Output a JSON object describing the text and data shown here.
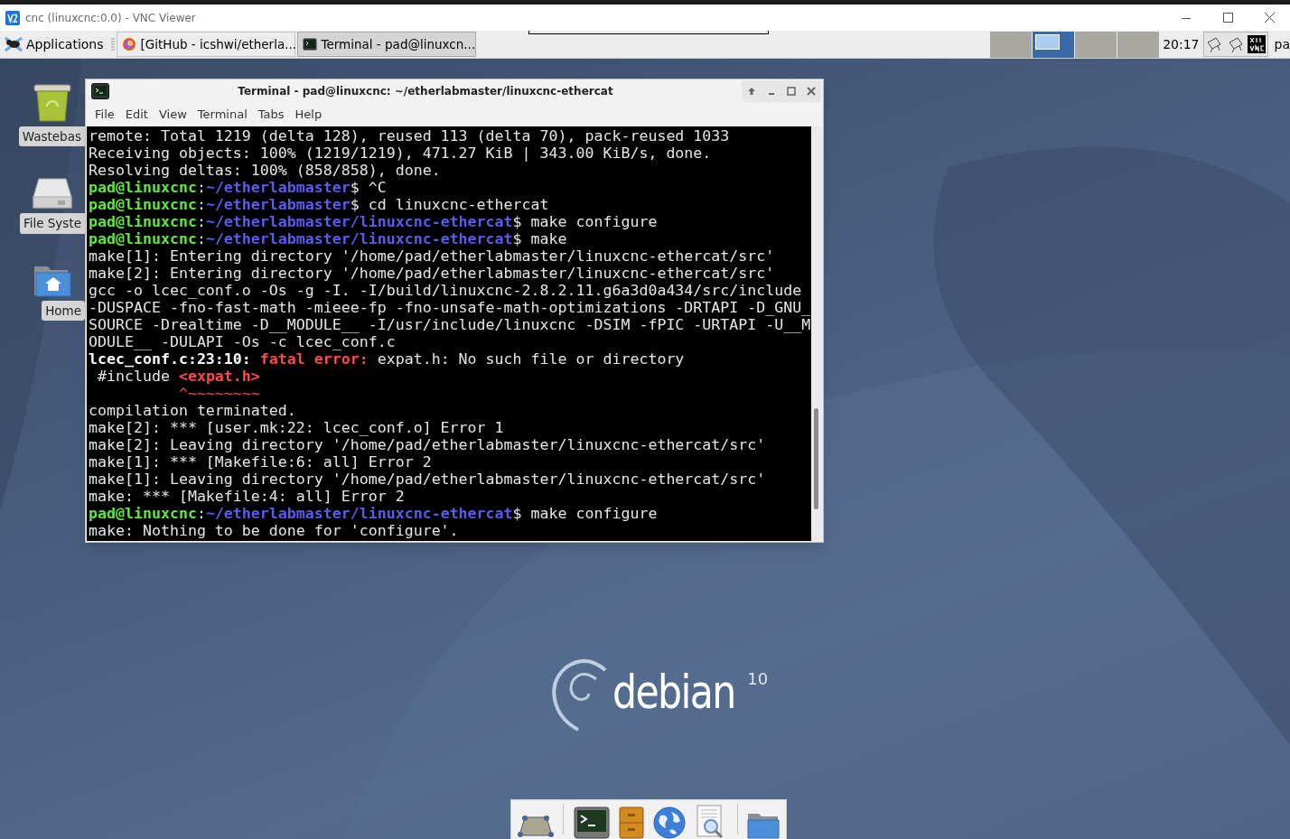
{
  "vnc_window": {
    "title": "cnc (linuxcnc:0.0) - VNC Viewer"
  },
  "panel": {
    "applications": "Applications",
    "tasks": [
      {
        "label": "[GitHub - icshwi/etherla...",
        "kind": "browser",
        "selected": false
      },
      {
        "label": "Terminal - pad@linuxcn...",
        "kind": "terminal",
        "selected": true
      }
    ],
    "workspaces": [
      {
        "selected": false,
        "has_window": false
      },
      {
        "selected": true,
        "has_window": true
      },
      {
        "selected": false,
        "has_window": false
      },
      {
        "selected": false,
        "has_window": false
      }
    ],
    "clock": "20:17",
    "user": "pa"
  },
  "desktop_icons": [
    {
      "label": "Wastebas",
      "kind": "trash"
    },
    {
      "label": "File Syste",
      "kind": "drive"
    },
    {
      "label": "Home",
      "kind": "home"
    }
  ],
  "terminal": {
    "title": "Terminal - pad@linuxcnc: ~/etherlabmaster/linuxcnc-ethercat",
    "menu": [
      "File",
      "Edit",
      "View",
      "Terminal",
      "Tabs",
      "Help"
    ],
    "lines": [
      [
        {
          "text": "remote: Total 1219 (delta 128), reused 113 (delta 70), pack-reused 1033",
          "kind": "plain"
        }
      ],
      [
        {
          "text": "Receiving objects: 100% (1219/1219), 471.27 KiB | 343.00 KiB/s, done.",
          "kind": "plain"
        }
      ],
      [
        {
          "text": "Resolving deltas: 100% (858/858), done.",
          "kind": "plain"
        }
      ],
      [
        {
          "text": "pad@linuxcnc",
          "kind": "user"
        },
        {
          "text": ":",
          "kind": "plain"
        },
        {
          "text": "~/etherlabmaster",
          "kind": "path"
        },
        {
          "text": "$ ^C",
          "kind": "plain"
        }
      ],
      [
        {
          "text": "pad@linuxcnc",
          "kind": "user"
        },
        {
          "text": ":",
          "kind": "plain"
        },
        {
          "text": "~/etherlabmaster",
          "kind": "path"
        },
        {
          "text": "$ cd linuxcnc-ethercat",
          "kind": "plain"
        }
      ],
      [
        {
          "text": "pad@linuxcnc",
          "kind": "user"
        },
        {
          "text": ":",
          "kind": "plain"
        },
        {
          "text": "~/etherlabmaster/linuxcnc-ethercat",
          "kind": "path"
        },
        {
          "text": "$ make configure",
          "kind": "plain"
        }
      ],
      [
        {
          "text": "pad@linuxcnc",
          "kind": "user"
        },
        {
          "text": ":",
          "kind": "plain"
        },
        {
          "text": "~/etherlabmaster/linuxcnc-ethercat",
          "kind": "path"
        },
        {
          "text": "$ make",
          "kind": "plain"
        }
      ],
      [
        {
          "text": "make[1]: Entering directory '/home/pad/etherlabmaster/linuxcnc-ethercat/src'",
          "kind": "plain"
        }
      ],
      [
        {
          "text": "make[2]: Entering directory '/home/pad/etherlabmaster/linuxcnc-ethercat/src'",
          "kind": "plain"
        }
      ],
      [
        {
          "text": "gcc -o lcec_conf.o -Os -g -I. -I/build/linuxcnc-2.8.2.11.g6a3d0a434/src/include",
          "kind": "plain"
        }
      ],
      [
        {
          "text": "-DUSPACE -fno-fast-math -mieee-fp -fno-unsafe-math-optimizations -DRTAPI -D_GNU_",
          "kind": "plain"
        }
      ],
      [
        {
          "text": "SOURCE -Drealtime -D__MODULE__ -I/usr/include/linuxcnc -DSIM -fPIC -URTAPI -U__M",
          "kind": "plain"
        }
      ],
      [
        {
          "text": "ODULE__ -DULAPI -Os -c lcec_conf.c",
          "kind": "plain"
        }
      ],
      [
        {
          "text": "lcec_conf.c:23:10:",
          "kind": "bold"
        },
        {
          "text": " fatal error:",
          "kind": "error"
        },
        {
          "text": " expat.h: No such file or directory",
          "kind": "plain"
        }
      ],
      [
        {
          "text": " #include ",
          "kind": "plain"
        },
        {
          "text": "<expat.h>",
          "kind": "error"
        }
      ],
      [
        {
          "text": "          ^~~~~~~~~",
          "kind": "red"
        }
      ],
      [
        {
          "text": "compilation terminated.",
          "kind": "plain"
        }
      ],
      [
        {
          "text": "make[2]: *** [user.mk:22: lcec_conf.o] Error 1",
          "kind": "plain"
        }
      ],
      [
        {
          "text": "make[2]: Leaving directory '/home/pad/etherlabmaster/linuxcnc-ethercat/src'",
          "kind": "plain"
        }
      ],
      [
        {
          "text": "make[1]: *** [Makefile:6: all] Error 2",
          "kind": "plain"
        }
      ],
      [
        {
          "text": "make[1]: Leaving directory '/home/pad/etherlabmaster/linuxcnc-ethercat/src'",
          "kind": "plain"
        }
      ],
      [
        {
          "text": "make: *** [Makefile:4: all] Error 2",
          "kind": "plain"
        }
      ],
      [
        {
          "text": "pad@linuxcnc",
          "kind": "user"
        },
        {
          "text": ":",
          "kind": "plain"
        },
        {
          "text": "~/etherlabmaster/linuxcnc-ethercat",
          "kind": "path"
        },
        {
          "text": "$ make configure",
          "kind": "plain"
        }
      ],
      [
        {
          "text": "make: Nothing to be done for 'configure'.",
          "kind": "plain"
        }
      ]
    ]
  },
  "wallpaper": {
    "logo_text": "debian",
    "version": "10"
  },
  "dock": [
    {
      "kind": "desktop"
    },
    {
      "kind": "separator"
    },
    {
      "kind": "terminal"
    },
    {
      "kind": "cabinet"
    },
    {
      "kind": "globe"
    },
    {
      "kind": "search"
    },
    {
      "kind": "separator"
    },
    {
      "kind": "folder"
    }
  ]
}
